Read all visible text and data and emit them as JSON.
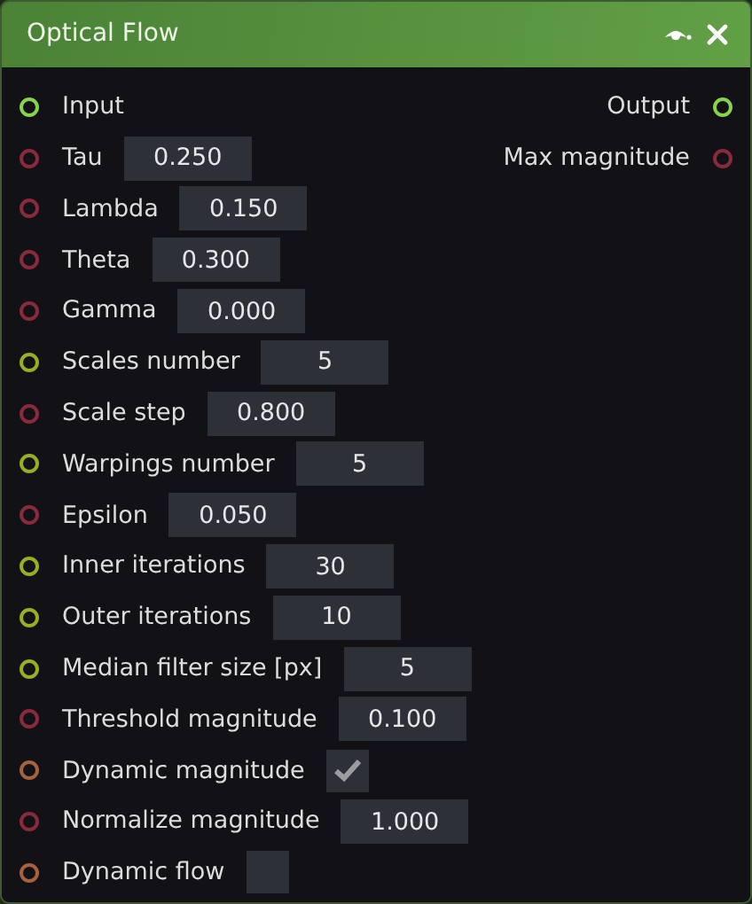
{
  "window": {
    "title": "Optical Flow"
  },
  "inputs": [
    {
      "label": "Input",
      "color": "#86d44a",
      "kind": "pin"
    },
    {
      "label": "Tau",
      "color": "#8a2a3c",
      "kind": "number",
      "value": "0.250"
    },
    {
      "label": "Lambda",
      "color": "#8a2a3c",
      "kind": "number",
      "value": "0.150"
    },
    {
      "label": "Theta",
      "color": "#8a2a3c",
      "kind": "number",
      "value": "0.300"
    },
    {
      "label": "Gamma",
      "color": "#8a2a3c",
      "kind": "number",
      "value": "0.000"
    },
    {
      "label": "Scales number",
      "color": "#9aae1e",
      "kind": "number",
      "value": "5"
    },
    {
      "label": "Scale step",
      "color": "#8a2a3c",
      "kind": "number",
      "value": "0.800"
    },
    {
      "label": "Warpings number",
      "color": "#9aae1e",
      "kind": "number",
      "value": "5"
    },
    {
      "label": "Epsilon",
      "color": "#8a2a3c",
      "kind": "number",
      "value": "0.050"
    },
    {
      "label": "Inner iterations",
      "color": "#9aae1e",
      "kind": "number",
      "value": "30"
    },
    {
      "label": "Outer iterations",
      "color": "#9aae1e",
      "kind": "number",
      "value": "10"
    },
    {
      "label": "Median filter size [px]",
      "color": "#9aae1e",
      "kind": "number",
      "value": "5"
    },
    {
      "label": "Threshold magnitude",
      "color": "#8a2a3c",
      "kind": "number",
      "value": "0.100"
    },
    {
      "label": "Dynamic magnitude",
      "color": "#a8613c",
      "kind": "checkbox",
      "checked": true
    },
    {
      "label": "Normalize magnitude",
      "color": "#8a2a3c",
      "kind": "number",
      "value": "1.000"
    },
    {
      "label": "Dynamic flow",
      "color": "#a8613c",
      "kind": "checkbox",
      "checked": false
    }
  ],
  "outputs": [
    {
      "label": "Output",
      "color": "#86d44a"
    },
    {
      "label": "Max magnitude",
      "color": "#8a2a3c"
    }
  ]
}
